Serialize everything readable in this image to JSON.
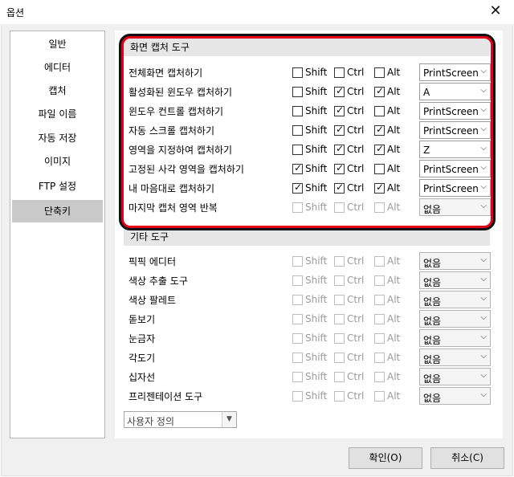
{
  "window": {
    "title": "옵션",
    "close_glyph": "✕"
  },
  "sidebar": {
    "items": [
      {
        "label": "일반"
      },
      {
        "label": "에디터"
      },
      {
        "label": "캡처"
      },
      {
        "label": "파일 이름"
      },
      {
        "label": "자동 저장"
      },
      {
        "label": "이미지"
      },
      {
        "label": "FTP 설정"
      },
      {
        "label": "단축키",
        "active": true
      }
    ]
  },
  "capture_group": {
    "title": "화면 캡처 도구",
    "rows": [
      {
        "label": "전체화면 캡처하기",
        "shift": false,
        "ctrl": false,
        "alt": false,
        "key": "PrintScreen",
        "enabled": true
      },
      {
        "label": "활성화된 윈도우 캡처하기",
        "shift": false,
        "ctrl": true,
        "alt": true,
        "key": "A",
        "enabled": true
      },
      {
        "label": "윈도우 컨트롤 캡처하기",
        "shift": false,
        "ctrl": true,
        "alt": false,
        "key": "PrintScreen",
        "enabled": true
      },
      {
        "label": "자동 스크롤 캡처하기",
        "shift": false,
        "ctrl": true,
        "alt": true,
        "key": "PrintScreen",
        "enabled": true
      },
      {
        "label": "영역을 지정하여 캡처하기",
        "shift": false,
        "ctrl": true,
        "alt": true,
        "key": "Z",
        "enabled": true
      },
      {
        "label": "고정된 사각 영역을 캡처하기",
        "shift": true,
        "ctrl": true,
        "alt": false,
        "key": "PrintScreen",
        "enabled": true
      },
      {
        "label": "내 마음대로 캡처하기",
        "shift": true,
        "ctrl": true,
        "alt": true,
        "key": "PrintScreen",
        "enabled": true
      },
      {
        "label": "마지막 캡처 영역 반복",
        "shift": false,
        "ctrl": false,
        "alt": false,
        "key": "없음",
        "enabled": false
      }
    ]
  },
  "other_group": {
    "title": "기타 도구",
    "rows": [
      {
        "label": "픽픽 에디터",
        "key": "없음"
      },
      {
        "label": "색상 추출 도구",
        "key": "없음"
      },
      {
        "label": "색상 팔레트",
        "key": "없음"
      },
      {
        "label": "돋보기",
        "key": "없음"
      },
      {
        "label": "눈금자",
        "key": "없음"
      },
      {
        "label": "각도기",
        "key": "없음"
      },
      {
        "label": "십자선",
        "key": "없음"
      },
      {
        "label": "프리젠테이션 도구",
        "key": "없음"
      }
    ]
  },
  "modifiers": {
    "shift": "Shift",
    "ctrl": "Ctrl",
    "alt": "Alt"
  },
  "preset_combo": {
    "value": "사용자 정의"
  },
  "buttons": {
    "ok": "확인(O)",
    "cancel": "취소(C)"
  }
}
